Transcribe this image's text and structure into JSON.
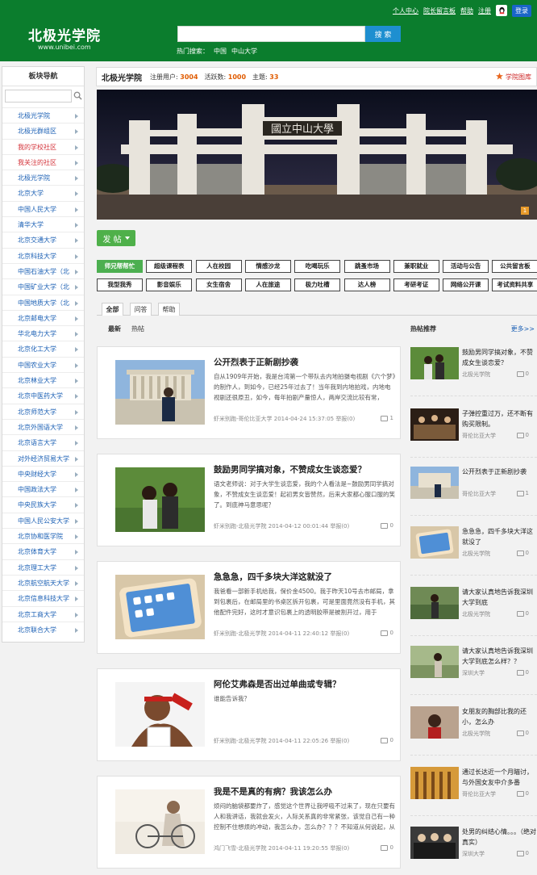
{
  "header": {
    "logo_text": "北极光学院",
    "logo_url": "www.unibei.com",
    "top_links": [
      "个人中心",
      "院长留言板",
      "帮助",
      "注册"
    ],
    "login_label": "登录",
    "search_placeholder": "",
    "search_button": "搜 索",
    "hot_search_label": "热门搜索：",
    "hot_search_terms": [
      "中国",
      "中山大学"
    ]
  },
  "sidebar": {
    "title": "板块导航",
    "items": [
      {
        "label": "北极光学院",
        "red": false
      },
      {
        "label": "北极光群组区",
        "red": false
      },
      {
        "label": "我的学校社区",
        "red": true
      },
      {
        "label": "我关注的社区",
        "red": true
      },
      {
        "label": "北极光学院",
        "red": false
      },
      {
        "label": "北京大学",
        "red": false
      },
      {
        "label": "中国人民大学",
        "red": false
      },
      {
        "label": "清华大学",
        "red": false
      },
      {
        "label": "北京交通大学",
        "red": false
      },
      {
        "label": "北京科技大学",
        "red": false
      },
      {
        "label": "中国石油大学（北",
        "red": false
      },
      {
        "label": "中国矿业大学（北",
        "red": false
      },
      {
        "label": "中国地质大学（北",
        "red": false
      },
      {
        "label": "北京邮电大学",
        "red": false
      },
      {
        "label": "华北电力大学",
        "red": false
      },
      {
        "label": "北京化工大学",
        "red": false
      },
      {
        "label": "中国农业大学",
        "red": false
      },
      {
        "label": "北京林业大学",
        "red": false
      },
      {
        "label": "北京中医药大学",
        "red": false
      },
      {
        "label": "北京师范大学",
        "red": false
      },
      {
        "label": "北京外国语大学",
        "red": false
      },
      {
        "label": "北京语言大学",
        "red": false
      },
      {
        "label": "对外经济贸易大学",
        "red": false
      },
      {
        "label": "中央财经大学",
        "red": false
      },
      {
        "label": "中国政法大学",
        "red": false
      },
      {
        "label": "中央民族大学",
        "red": false
      },
      {
        "label": "中国人民公安大学",
        "red": false
      },
      {
        "label": "北京协和医学院",
        "red": false
      },
      {
        "label": "北京体育大学",
        "red": false
      },
      {
        "label": "北京理工大学",
        "red": false
      },
      {
        "label": "北京航空航天大学",
        "red": false
      },
      {
        "label": "北京信息科技大学",
        "red": false
      },
      {
        "label": "北京工商大学",
        "red": false
      },
      {
        "label": "北京联合大学",
        "red": false
      }
    ]
  },
  "info_bar": {
    "site_name": "北极光学院",
    "registered_label": "注册用户:",
    "registered_value": "3004",
    "active_label": "活跃数:",
    "active_value": "1000",
    "topics_label": "主题:",
    "topics_value": "33",
    "album_label": "学院图库"
  },
  "banner": {
    "gate_text": "國立中山大學",
    "page_indicator": "1"
  },
  "post_button": "发 帖",
  "categories": [
    {
      "label": "师兄帮帮忙",
      "active": true
    },
    {
      "label": "超级课程表",
      "active": false
    },
    {
      "label": "人在校园",
      "active": false
    },
    {
      "label": "情感沙龙",
      "active": false
    },
    {
      "label": "吃喝玩乐",
      "active": false
    },
    {
      "label": "跳蚤市场",
      "active": false
    },
    {
      "label": "兼职就业",
      "active": false
    },
    {
      "label": "活动与公告",
      "active": false
    },
    {
      "label": "公共留言板",
      "active": false
    },
    {
      "label": "我型我秀",
      "active": false
    },
    {
      "label": "影音娱乐",
      "active": false
    },
    {
      "label": "女生宿舍",
      "active": false
    },
    {
      "label": "人在旅途",
      "active": false
    },
    {
      "label": "极力吐槽",
      "active": false
    },
    {
      "label": "达人榜",
      "active": false
    },
    {
      "label": "考研考证",
      "active": false
    },
    {
      "label": "网络公开课",
      "active": false
    },
    {
      "label": "考试资料共享",
      "active": false
    }
  ],
  "tabs": [
    "全部",
    "问答",
    "帮助"
  ],
  "latest_bar": {
    "latest": "最新",
    "hot": "热帖"
  },
  "hot_bar": {
    "title": "热帖推荐",
    "more": "更多>>"
  },
  "posts": [
    {
      "title": "公开烈表于正新剧抄袭",
      "body": "自从1909年开始，我是台湾第一个带队去内地拍摄电视剧《六个梦》的制作人，到如今，已经25年过去了！当年我到内地拍戏，内地电视剧还很原丑，如今，每年拍剧产量惊人，两岸交流比较有常，",
      "meta": "虾米别跑-哥伦比亚大学  2014-04-24 15:37:05   举报(0)",
      "count": "1"
    },
    {
      "title": "鼓励男同学搞对象，不赞成女生谈恋爱？",
      "body": "语文老师说：对于大学生谈恋爱，我的个人看法是~鼓励男同学搞对象，不赞成女生谈恋爱！起初男女皆赞然，后来大家都心服口服的笑了。到底神马意思呢？",
      "meta": "虾米别跑-北极光学院  2014-04-12 00:01:44   举报(0)",
      "count": "0"
    },
    {
      "title": "急急急，四千多块大洋这就没了",
      "body": "我爸看一部新手机给我，保价金4500。我于昨天10号去市邮局，拿到包裹后，在邮局里的书桌区拆开包裹，可是里面竟然没有手机，其他配件完好，这时才意识包裹上的透明胶带是被割开过，用于",
      "meta": "虾米别跑-北极光学院  2014-04-11 22:40:12   举报(0)",
      "count": "0"
    },
    {
      "title": "阿伦艾弗森是否出过单曲或专辑？",
      "body": "谁能告诉我？",
      "meta": "虾米别跑-北极光学院  2014-04-11 22:05:26   举报(0)",
      "count": "0"
    },
    {
      "title": "我是不是真的有病？我该怎么办",
      "body": "烦闷的脑袋都要炸了，感觉这个世界让我呼吸不过来了，现在只要有人和我讲话，我就会发火，人际关系真的非常紧张，该觉自己有一种控制不住想烦的冲动，我怎么办，怎么办？？？不知道从何说起，从",
      "meta": "鸿门飞雪-北极光学院  2014-04-11 19:20:55   举报(0)",
      "count": "0"
    }
  ],
  "hot_list": [
    {
      "title": "鼓励男同学搞对象，不赞成女生谈恋爱？",
      "src": "北极光学院",
      "count": "0"
    },
    {
      "title": "子弹控重过万，还不断有购买限制。",
      "src": "哥伦比亚大学",
      "count": "0"
    },
    {
      "title": "公开烈表于正新剧抄袭",
      "src": "哥伦比亚大学",
      "count": "1"
    },
    {
      "title": "急急急，四千多块大洋这就没了",
      "src": "北极光学院",
      "count": "0"
    },
    {
      "title": "请大家认真地告诉我深圳大学到底",
      "src": "北极光学院",
      "count": "0"
    },
    {
      "title": "请大家认真地告诉我深圳大学到底怎么样？？",
      "src": "深圳大学",
      "count": "0"
    },
    {
      "title": "女朋友的胸部比我的还小，怎么办",
      "src": "北极光学院",
      "count": "0"
    },
    {
      "title": "通过长达近一个月瞄讨，与外国女友中介多番",
      "src": "哥伦比亚大学",
      "count": "0"
    },
    {
      "title": "处男的纠结心情。。。（绝对真实）",
      "src": "深圳大学",
      "count": "0"
    }
  ],
  "colors": {
    "header_green": "#0b7d2d",
    "accent_orange": "#e05b00",
    "link_blue": "#1a5fb4",
    "active_green": "#4caf50"
  }
}
